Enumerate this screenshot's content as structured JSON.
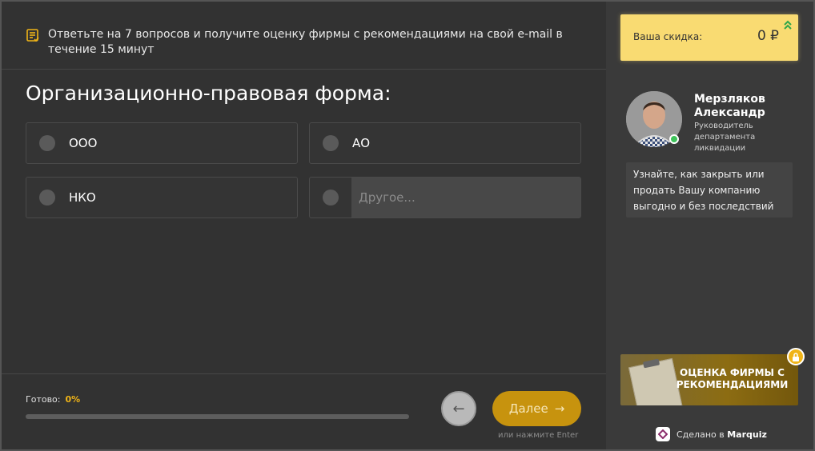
{
  "hint": {
    "icon": "checklist-icon",
    "text": "Ответьте на 7 вопросов и получите оценку фирмы с рекомендациями на свой e-mail в течение 15 минут"
  },
  "question": {
    "title": "Организационно-правовая форма:",
    "options": [
      {
        "label": "ООО"
      },
      {
        "label": "АО"
      },
      {
        "label": "НКО"
      }
    ],
    "other_placeholder": "Другое..."
  },
  "progress": {
    "label": "Готово:",
    "value_text": "0%",
    "fraction": 0.0
  },
  "nav": {
    "back_icon": "←",
    "next_label": "Далее",
    "next_icon": "→",
    "enter_hint": "или нажмите Enter"
  },
  "discount": {
    "label": "Ваша скидка:",
    "value": "0 ₽"
  },
  "manager": {
    "name": "Мерзляков Александр",
    "role": "Руководитель департамента ликвидации",
    "message": "Узнайте, как закрыть или продать Вашу компанию выгодно и без последствий"
  },
  "bonus": {
    "text": "Оценка фирмы с рекомендациями",
    "lock_icon": "lock-icon"
  },
  "footer": {
    "made_by": "Сделано в",
    "brand": "Marquiz"
  },
  "colors": {
    "accent": "#f0b417",
    "discount_bg": "#f9db72",
    "background": "#323232",
    "sidebar": "#3a3a3a"
  }
}
